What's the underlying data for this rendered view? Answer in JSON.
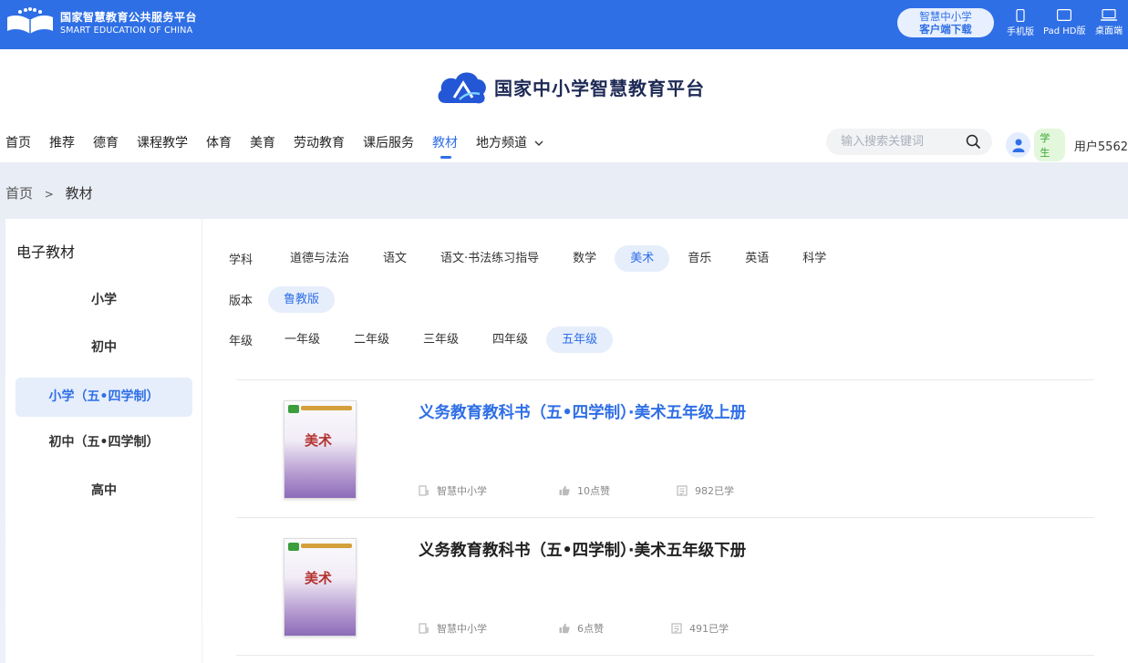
{
  "topbar": {
    "brand_cn": "国家智慧教育公共服务平台",
    "brand_en": "SMART EDUCATION OF CHINA",
    "download_l1": "智慧中小学",
    "download_l2": "客户端下载",
    "devices": [
      {
        "label": "手机版",
        "icon": "phone-icon"
      },
      {
        "label": "Pad HD版",
        "icon": "tablet-icon"
      },
      {
        "label": "桌面端",
        "icon": "laptop-icon"
      }
    ],
    "bg_color": "#2f6fe6"
  },
  "header": {
    "platform_title": "国家中小学智慧教育平台"
  },
  "nav": {
    "items": [
      "首页",
      "推荐",
      "德育",
      "课程教学",
      "体育",
      "美育",
      "劳动教育",
      "课后服务",
      "教材",
      "地方频道"
    ],
    "active": "教材",
    "accent_color": "#2f6fe6"
  },
  "search": {
    "placeholder": "输入搜索关键词"
  },
  "user": {
    "role": "学生",
    "name": "用户5562"
  },
  "breadcrumb": {
    "home": "首页",
    "sep": ">",
    "current": "教材"
  },
  "sidebar": {
    "title": "电子教材",
    "items": [
      "小学",
      "初中",
      "小学（五•四学制）",
      "初中（五•四学制）",
      "高中"
    ],
    "active": "小学（五•四学制）"
  },
  "filters": {
    "subject_label": "学科",
    "subjects": [
      "道德与法治",
      "语文",
      "语文·书法练习指导",
      "数学",
      "美术",
      "音乐",
      "英语",
      "科学"
    ],
    "subject_active": "美术",
    "edition_label": "版本",
    "editions": [
      "鲁教版"
    ],
    "edition_active": "鲁教版",
    "grade_label": "年级",
    "grades": [
      "一年级",
      "二年级",
      "三年级",
      "四年级",
      "五年级"
    ],
    "grade_active": "五年级"
  },
  "books": [
    {
      "title": "义务教育教科书（五•四学制）·美术五年级上册",
      "cover_title": "美术",
      "publisher": "智慧中小学",
      "likes": "10点赞",
      "learners": "982已学"
    },
    {
      "title": "义务教育教科书（五•四学制）·美术五年级下册",
      "cover_title": "美术",
      "publisher": "智慧中小学",
      "likes": "6点赞",
      "learners": "491已学"
    }
  ]
}
